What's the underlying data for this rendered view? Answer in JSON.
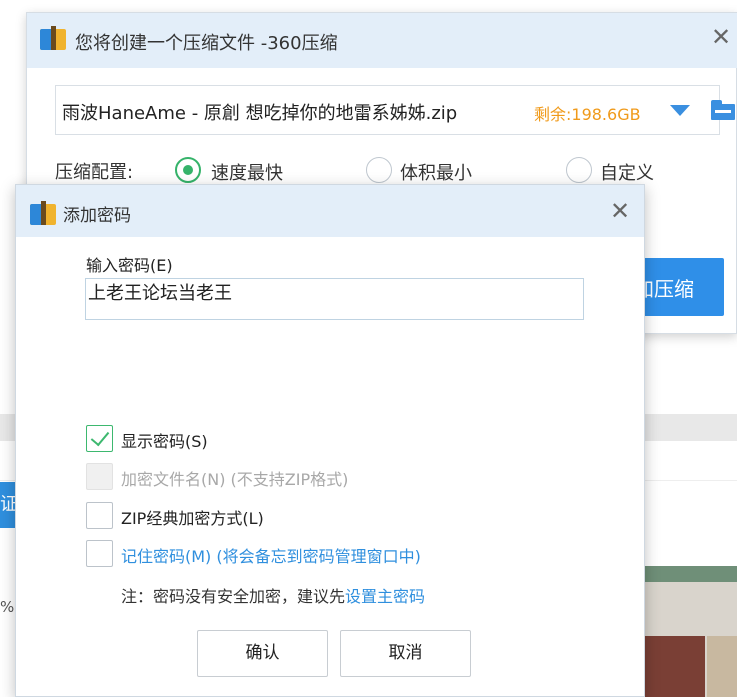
{
  "background": {
    "chip_text": "证",
    "percent_text": "%)"
  },
  "main_window": {
    "title": "您将创建一个压缩文件 -360压缩",
    "close_glyph": "✕",
    "file_path": "雨波HaneAme - 原創 想吃掉你的地雷系姊姊.zip",
    "free_space": "剩余:198.6GB",
    "config_label": "压缩配置:",
    "config_options": [
      {
        "label": "速度最快",
        "selected": true
      },
      {
        "label": "体积最小",
        "selected": false
      },
      {
        "label": "自定义",
        "selected": false
      }
    ],
    "compress_button": "加压缩",
    "accent_color": "#2f8fe8"
  },
  "password_dialog": {
    "title": "添加密码",
    "close_glyph": "✕",
    "password_label": "输入密码(E)",
    "password_value": "上老王论坛当老王",
    "options": {
      "show_password": {
        "label": "显示密码(S)",
        "checked": true
      },
      "encrypt_filenames": {
        "label": "加密文件名(N) (不支持ZIP格式)",
        "checked": false,
        "disabled": true
      },
      "zip_classic": {
        "label": "ZIP经典加密方式(L)",
        "checked": false
      },
      "remember_password": {
        "label": "记住密码(M) (将会备忘到密码管理窗口中)",
        "checked": false
      }
    },
    "note_prefix": "注：密码没有安全加密，建议先",
    "note_link": "设置主密码",
    "confirm_button": "确认",
    "cancel_button": "取消",
    "check_color": "#3db86f",
    "link_color": "#2f8fde"
  }
}
